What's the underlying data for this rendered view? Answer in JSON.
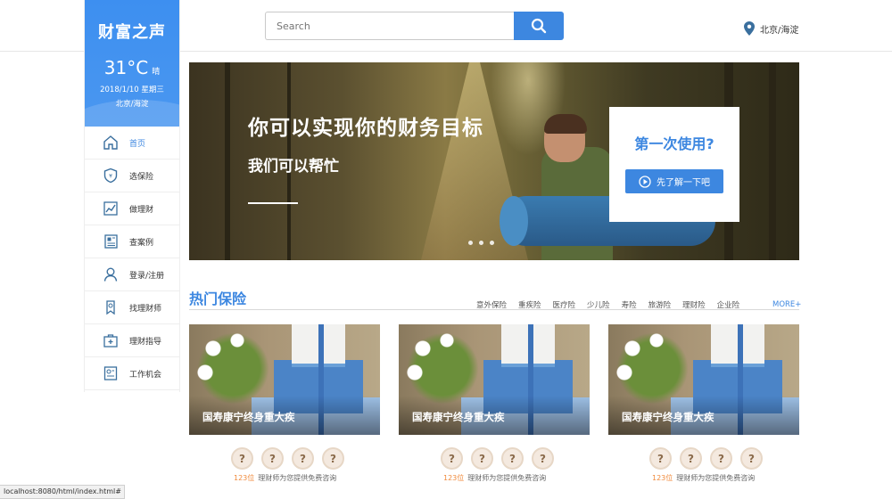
{
  "search": {
    "placeholder": "Search"
  },
  "location": {
    "text": "北京/海淀"
  },
  "brand": {
    "logo": "财富之声",
    "temperature": "31°C",
    "condition": "晴",
    "date": "2018/1/10  星期三",
    "city": "北京/海淀"
  },
  "sidebar": {
    "items": [
      {
        "label": "首页",
        "icon": "home-icon",
        "active": true
      },
      {
        "label": "选保险",
        "icon": "shield-icon",
        "active": false
      },
      {
        "label": "做理财",
        "icon": "chart-icon",
        "active": false
      },
      {
        "label": "查案例",
        "icon": "newspaper-icon",
        "active": false
      },
      {
        "label": "登录/注册",
        "icon": "user-icon",
        "active": false
      },
      {
        "label": "找理财师",
        "icon": "advisor-icon",
        "active": false
      },
      {
        "label": "理财指导",
        "icon": "briefcase-icon",
        "active": false
      },
      {
        "label": "工作机会",
        "icon": "job-icon",
        "active": false
      }
    ]
  },
  "banner": {
    "headline": "你可以实现你的财务目标",
    "subline": "我们可以帮忙",
    "promo_title": "第一次使用?",
    "promo_button": "先了解一下吧",
    "slides": 3
  },
  "section": {
    "title": "热门保险",
    "categories": [
      "意外保险",
      "重疾险",
      "医疗险",
      "少儿险",
      "寿险",
      "旅游险",
      "理财险",
      "企业险"
    ],
    "more": "MORE+"
  },
  "cards": [
    {
      "title": "国寿康宁终身重大疾",
      "advisor_count": "123位",
      "advisor_text": "理财师为您提供免费咨询",
      "advisor_icon": "?"
    },
    {
      "title": "国寿康宁终身重大疾",
      "advisor_count": "123位",
      "advisor_text": "理财师为您提供免费咨询",
      "advisor_icon": "?"
    },
    {
      "title": "国寿康宁终身重大疾",
      "advisor_count": "123位",
      "advisor_text": "理财师为您提供免费咨询",
      "advisor_icon": "?"
    }
  ],
  "statusbar": {
    "url": "localhost:8080/html/index.html#"
  },
  "colors": {
    "accent": "#3d87e0",
    "highlight": "#f08a3c"
  }
}
